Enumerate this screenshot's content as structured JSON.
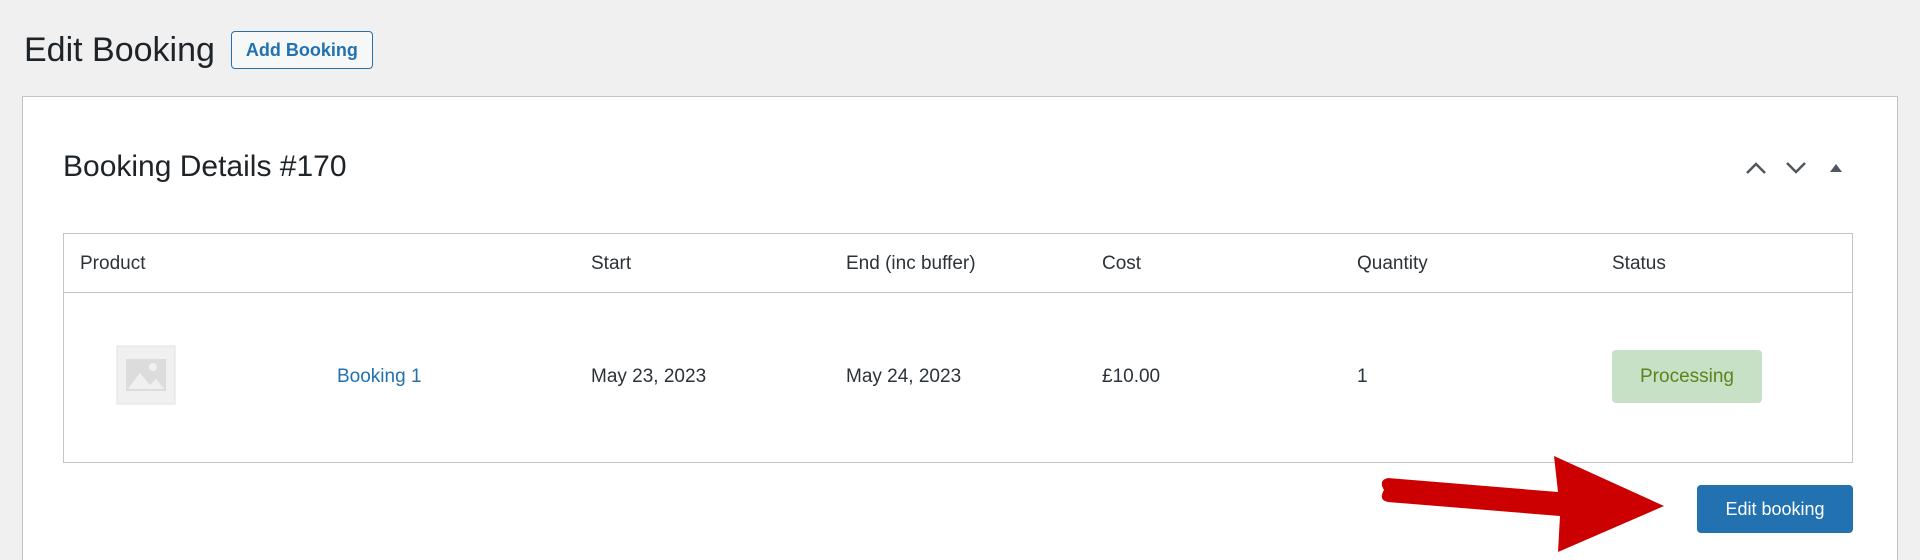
{
  "header": {
    "title": "Edit Booking",
    "add_button_label": "Add Booking"
  },
  "panel": {
    "title": "Booking Details #170",
    "controls": [
      "chevron-up-icon",
      "chevron-down-icon",
      "toggle-arrow-icon"
    ]
  },
  "table": {
    "columns": {
      "product": "Product",
      "start": "Start",
      "end": "End (inc buffer)",
      "cost": "Cost",
      "quantity": "Quantity",
      "status": "Status"
    },
    "rows": [
      {
        "product_name": "Booking 1",
        "start": "May 23, 2023",
        "end": "May 24, 2023",
        "cost": "£10.00",
        "quantity": "1",
        "status": "Processing"
      }
    ]
  },
  "actions": {
    "edit_booking_label": "Edit booking"
  },
  "colors": {
    "accent": "#2271b1",
    "status_bg": "#c6e1c6",
    "status_text": "#5b841b",
    "annotation_arrow": "#cc0000"
  }
}
